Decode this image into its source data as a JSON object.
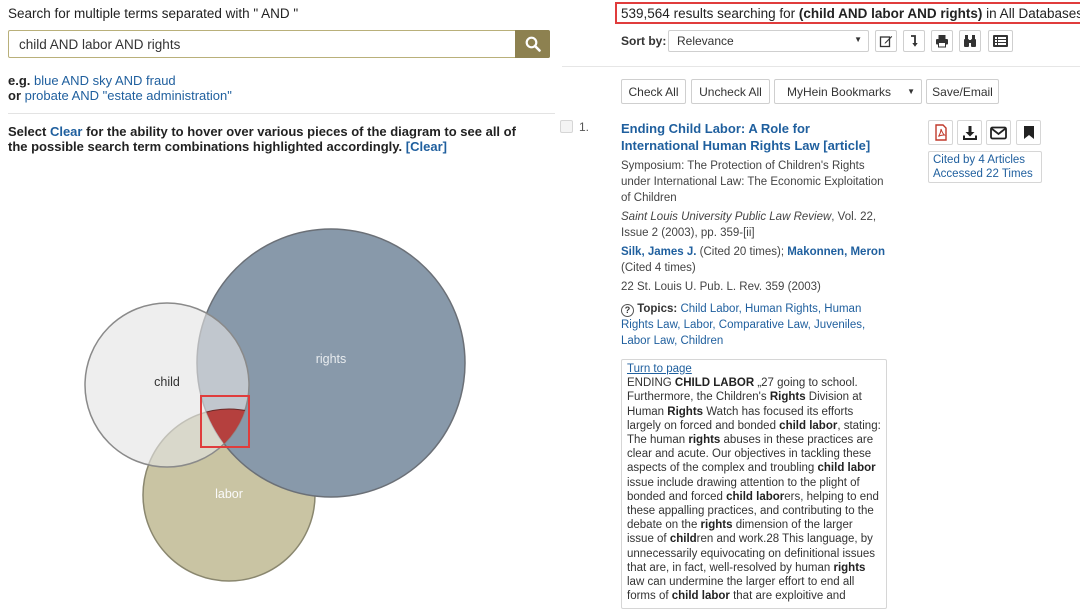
{
  "search": {
    "label": "Search for multiple terms separated with \" AND \"",
    "value": "child AND labor AND rights",
    "button_icon": "search-icon"
  },
  "examples": {
    "prefix1": "e.g.",
    "link1": "blue AND sky AND fraud",
    "prefix2": "or",
    "link2": "probate AND \"estate administration\""
  },
  "instructions": {
    "before": "Select",
    "clear_word": "Clear",
    "after": "for the ability to hover over various pieces of the diagram to see all of the possible search term combinations highlighted accordingly.",
    "clear_link": "[Clear]"
  },
  "venn": {
    "circles": [
      {
        "label": "child",
        "fill": "#e3e3e3",
        "stroke": "#8a8a8a"
      },
      {
        "label": "rights",
        "fill": "#8899aa",
        "stroke": "#6b7077"
      },
      {
        "label": "labor",
        "fill": "#c9c4a3",
        "stroke": "#8a876f"
      }
    ],
    "intersection_color": "#b5403e",
    "highlight_color": "#e03c3c"
  },
  "results": {
    "count": "539,564",
    "summary_before": "results searching for",
    "query": "(child AND labor AND rights)",
    "summary_after": "in All Databases."
  },
  "sort": {
    "label": "Sort by:",
    "selected": "Relevance",
    "tools": [
      "edit-icon",
      "sort-direction-icon",
      "print-icon",
      "binoculars-icon",
      "list-view-icon"
    ]
  },
  "actions": {
    "check_all": "Check All",
    "uncheck_all": "Uncheck All",
    "bookmarks": "MyHein Bookmarks",
    "save_email": "Save/Email"
  },
  "result": {
    "number": "1.",
    "title": "Ending Child Labor: A Role for International Human Rights Law [article]",
    "subtitle": "Symposium: The Protection of Children's Rights under International Law: The Economic Exploitation of Children",
    "journal": "Saint Louis University Public Law Review",
    "citation": ", Vol. 22, Issue 2 (2003), pp. 359-[ii]",
    "author1": "Silk, James J.",
    "author1_cited": "(Cited 20 times);",
    "author2": "Makonnen, Meron",
    "author2_cited": "(Cited 4 times)",
    "short_cite": "22 St. Louis U. Pub. L. Rev. 359 (2003)",
    "topics_label": "Topics:",
    "topics": "Child Labor, Human Rights, Human Rights Law, Labor, Comparative Law, Juveniles, Labor Law, Children",
    "cited_by": "Cited by 4 Articles",
    "accessed": "Accessed 22 Times",
    "icons": [
      "pdf-icon",
      "download-icon",
      "email-icon",
      "bookmark-icon"
    ],
    "snippet": {
      "turn_to_page": "Turn to page",
      "text": "ENDING CHILD LABOR „27 going to school. Furthermore, the Children's Rights Division at Human Rights Watch has focused its efforts largely on forced and bonded child labor, stating: The human rights abuses in these practices are clear and acute. Our objectives in tackling these aspects of the complex and troubling child labor issue include drawing attention to the plight of bonded and forced child laborers, helping to end these appalling practices, and contributing to the debate on the rights dimension of the larger issue of children and work.28 This language, by unnecessarily equivocating on definitional issues that are, in fact, well-resolved by human rights law can undermine the larger effort to end all forms of child labor that are exploitive and"
    }
  }
}
